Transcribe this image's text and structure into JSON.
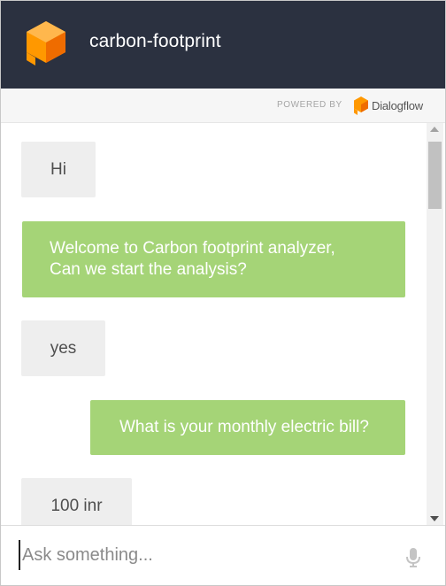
{
  "header": {
    "title": "carbon-footprint",
    "background_color": "#2b3140",
    "logo_icon": "dialogflow-cube-icon"
  },
  "powered_by": {
    "label": "POWERED BY",
    "brand": "Dialogflow"
  },
  "messages": [
    {
      "sender": "user",
      "text": "Hi"
    },
    {
      "sender": "bot",
      "text_lines": [
        "Welcome to Carbon footprint analyzer,",
        "Can we start the analysis?"
      ]
    },
    {
      "sender": "user",
      "text": "yes"
    },
    {
      "sender": "bot",
      "text": "What is your monthly electric bill?"
    },
    {
      "sender": "user",
      "text": "100 inr"
    }
  ],
  "colors": {
    "bot_bubble": "#a5d477",
    "user_bubble": "#eeeeee",
    "logo_orange": "#f57c00"
  },
  "input": {
    "placeholder": "Ask something...",
    "value": ""
  },
  "mic_icon": "microphone-icon"
}
